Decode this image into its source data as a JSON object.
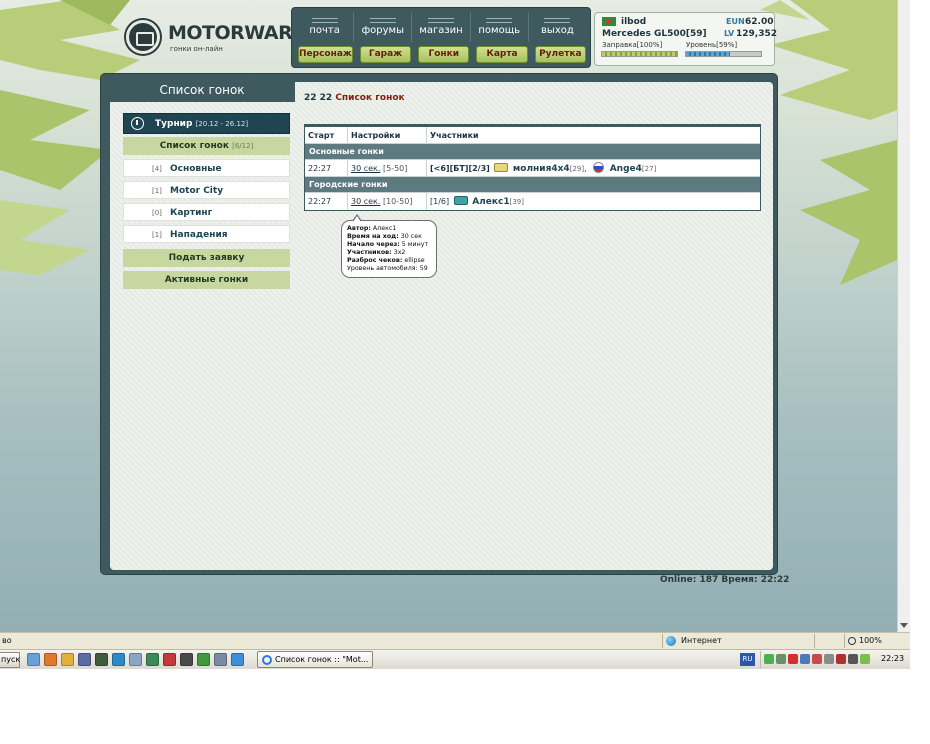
{
  "site": {
    "logo_name": "MOTORWARS.RU",
    "logo_tagline": "гонки он-лайн"
  },
  "top_links": [
    "почта",
    "форумы",
    "магазин",
    "помощь",
    "выход"
  ],
  "top_buttons": [
    "Персонаж",
    "Гараж",
    "Гонки",
    "Карта",
    "Рулетка"
  ],
  "user": {
    "name": "ilbod",
    "car": "Mercedes GL500[59]",
    "eun_label": "EUN",
    "eun_value": "62.00",
    "lv_label": "LV",
    "lv_value": "129,352",
    "fuel_label": "Заправка[100%]",
    "fuel_percent": 100,
    "level_label": "Уровень[59%]",
    "level_percent": 59
  },
  "sidebar": {
    "title": "Список гонок",
    "tournament": {
      "label": "Турнир",
      "dates": "[20.12 - 26.12]"
    },
    "race_list": {
      "label": "Список гонок",
      "count": "[6/12]"
    },
    "items": [
      {
        "count": "[4]",
        "label": "Основные"
      },
      {
        "count": "[1]",
        "label": "Motor City"
      },
      {
        "count": "[0]",
        "label": "Картинг"
      },
      {
        "count": "[1]",
        "label": "Нападения"
      }
    ],
    "apply_button": "Подать заявку",
    "active_button": "Активные гонки"
  },
  "content": {
    "time": "22 22",
    "title": "Список гонок",
    "table": {
      "headers": [
        "Старт",
        "Настройки",
        "Участники"
      ],
      "groups": [
        {
          "name": "Основные гонки",
          "rows": [
            {
              "start": "22:27",
              "settings_link": "30 сек.",
              "settings_range": "[5-50]",
              "prefix": "[<6][БТ][2/3]",
              "participants": [
                {
                  "name": "молния4х4",
                  "level": "[29]",
                  "icon": "car-icon-yellow"
                },
                {
                  "name": "Ange4",
                  "level": "[27]",
                  "icon": "russia-flag-icon"
                }
              ],
              "separator": ","
            }
          ]
        },
        {
          "name": "Городские гонки",
          "rows": [
            {
              "start": "22:27",
              "settings_link": "30 сек.",
              "settings_range": "[10-50]",
              "prefix": "[1/6]",
              "participants": [
                {
                  "name": "Алекс1",
                  "level": "[39]",
                  "icon": "car-icon-teal"
                }
              ]
            }
          ]
        }
      ]
    },
    "tooltip": [
      {
        "label": "Автор:",
        "value": "Алекс1"
      },
      {
        "label": "Время на ход:",
        "value": "30 сек"
      },
      {
        "label": "Начало через:",
        "value": "5 минут"
      },
      {
        "label": "Участников:",
        "value": "3x2"
      },
      {
        "label": "Разброс чеков:",
        "value": "ellipse"
      },
      {
        "label": "Уровень автомобиля:",
        "value": "59"
      }
    ]
  },
  "footer": {
    "online_label": "Online:",
    "online_value": "187",
    "time_label": "Время:",
    "time_value": "22:22"
  },
  "statusbar": {
    "left_text": "во",
    "zone": "Интернет",
    "zoom": "100%"
  },
  "taskbar": {
    "start": "пуск",
    "task_title": "Список гонок :: \"Mot...",
    "lang": "RU",
    "clock": "22:23"
  },
  "colors": {
    "frame": "#3e5a5e",
    "accent_red": "#8a1a0e",
    "button_green": "#a6c25c",
    "sidebar_dark": "#1f4552"
  }
}
